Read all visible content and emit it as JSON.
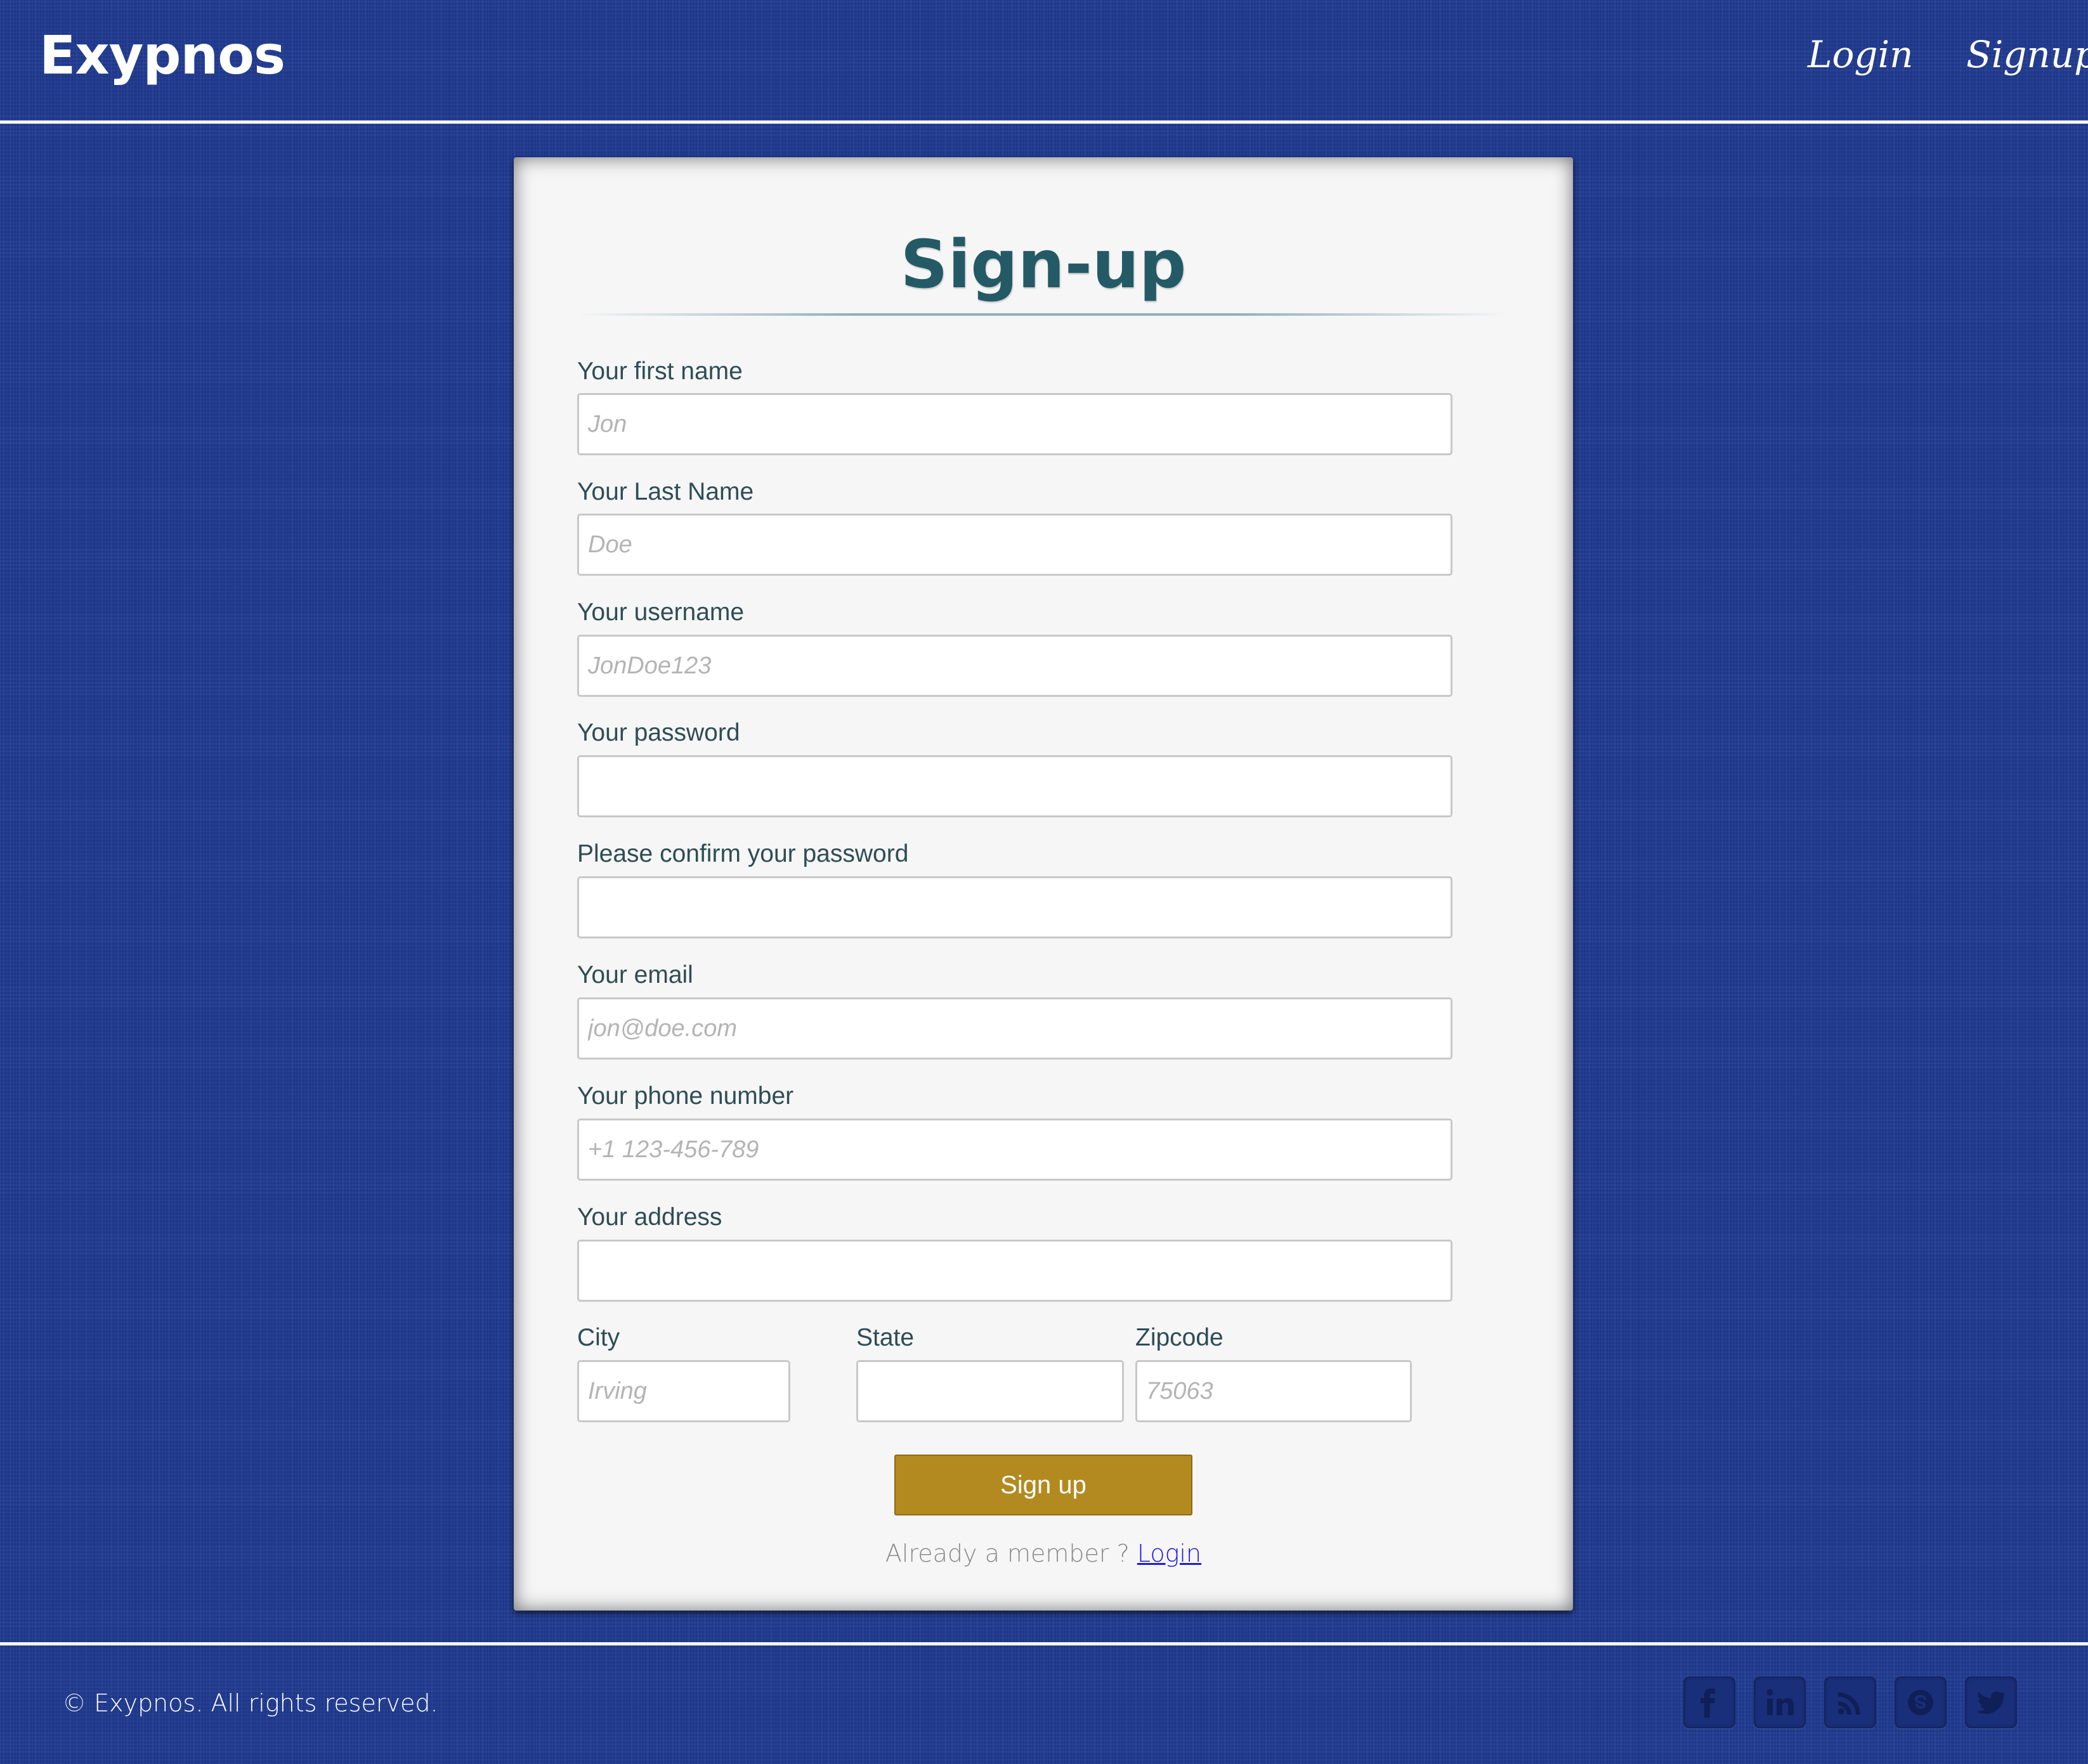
{
  "header": {
    "brand": "Exypnos",
    "nav": {
      "login": "Login",
      "signup": "Signup"
    }
  },
  "form": {
    "title": "Sign-up",
    "fields": {
      "first_name": {
        "label": "Your first name",
        "placeholder": "Jon"
      },
      "last_name": {
        "label": "Your Last Name",
        "placeholder": "Doe"
      },
      "username": {
        "label": "Your username",
        "placeholder": "JonDoe123"
      },
      "password": {
        "label": "Your password",
        "placeholder": ""
      },
      "confirm_password": {
        "label": "Please confirm your password",
        "placeholder": ""
      },
      "email": {
        "label": "Your email",
        "placeholder": "jon@doe.com"
      },
      "phone": {
        "label": "Your phone number",
        "placeholder": "+1 123-456-789"
      },
      "address": {
        "label": "Your address",
        "placeholder": ""
      },
      "city": {
        "label": "City",
        "placeholder": "Irving"
      },
      "state": {
        "label": "State",
        "placeholder": ""
      },
      "zipcode": {
        "label": "Zipcode",
        "placeholder": "75063"
      }
    },
    "submit_label": "Sign up",
    "member_text": "Already a member ?",
    "member_link": "Login"
  },
  "footer": {
    "copyright": "© Exypnos. All rights reserved.",
    "social": [
      "facebook-icon",
      "linkedin-icon",
      "rss-icon",
      "skype-icon",
      "twitter-icon"
    ]
  },
  "colors": {
    "background": "#1f3a92",
    "card": "#f6f6f6",
    "title": "#235a66",
    "button": "#b38a20",
    "link": "#1a1ae6"
  }
}
